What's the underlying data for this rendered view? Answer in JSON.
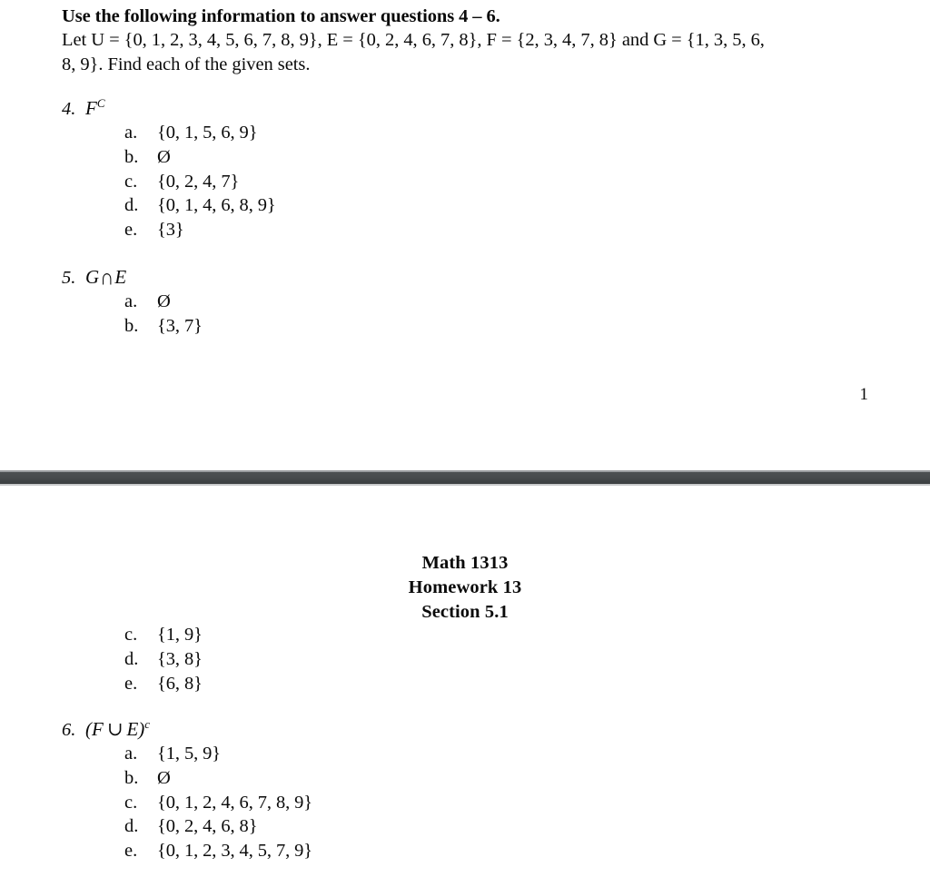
{
  "page_one": {
    "intro": {
      "heading": "Use the following information to answer questions 4 – 6.",
      "body_line_1": "Let U = {0, 1, 2, 3, 4, 5, 6, 7, 8, 9}, E = {0, 2, 4, 6, 7, 8}, F = {2, 3, 4, 7, 8} and G = {1, 3, 5, 6,",
      "body_line_2": "8, 9}.  Find each of the given sets."
    },
    "question_4": {
      "number": "4.",
      "stem_base": "F",
      "stem_superscript": "C",
      "options": [
        {
          "label": "a.",
          "value": "{0, 1, 5, 6, 9}"
        },
        {
          "label": "b.",
          "value": "Ø"
        },
        {
          "label": "c.",
          "value": "{0, 2, 4, 7}"
        },
        {
          "label": "d.",
          "value": "{0, 1, 4, 6, 8, 9}"
        },
        {
          "label": "e.",
          "value": "{3}"
        }
      ]
    },
    "question_5": {
      "number": "5.",
      "stem_left": "G",
      "stem_operator": "∩",
      "stem_right": "E",
      "options": [
        {
          "label": "a.",
          "value": "Ø"
        },
        {
          "label": "b.",
          "value": "{3, 7}"
        }
      ]
    },
    "page_number": "1"
  },
  "page_two": {
    "header": {
      "line_1": "Math 1313",
      "line_2": "Homework 13",
      "line_3": "Section 5.1"
    },
    "question_5_continued": {
      "options": [
        {
          "label": "c.",
          "value": "{1, 9}"
        },
        {
          "label": "d.",
          "value": "{3, 8}"
        },
        {
          "label": "e.",
          "value": "{6, 8}"
        }
      ]
    },
    "question_6": {
      "number": "6.",
      "stem_open": "(",
      "stem_left": "F",
      "stem_operator": "∪",
      "stem_right": "E",
      "stem_close": ")",
      "stem_superscript": "c",
      "options": [
        {
          "label": "a.",
          "value": "{1, 5, 9}"
        },
        {
          "label": "b.",
          "value": "Ø"
        },
        {
          "label": "c.",
          "value": "{0, 1, 2, 4, 6, 7, 8, 9}"
        },
        {
          "label": "d.",
          "value": "{0, 2, 4, 6, 8}"
        },
        {
          "label": "e.",
          "value": "{0, 1, 2, 3, 4, 5, 7, 9}"
        }
      ]
    }
  }
}
